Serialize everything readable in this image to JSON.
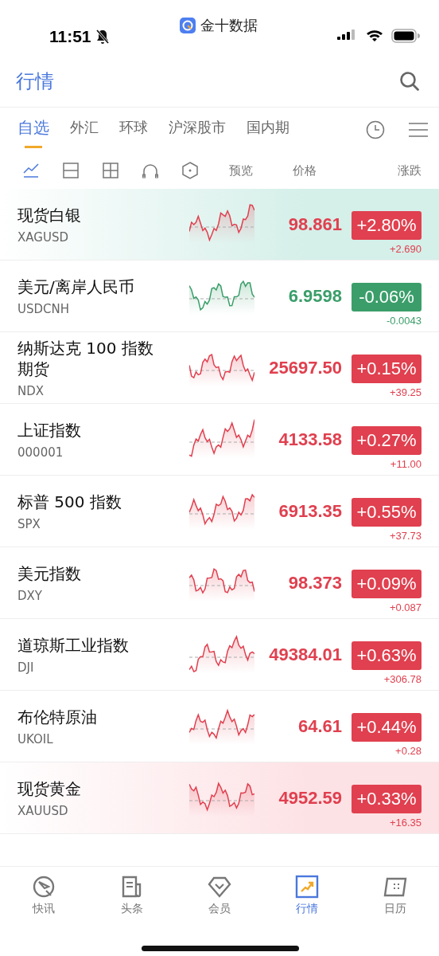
{
  "status_bar": {
    "time": "11:51",
    "back_app": "金十数据"
  },
  "header": {
    "title": "行情"
  },
  "tabs": [
    {
      "label": "自选",
      "selected": true
    },
    {
      "label": "外汇",
      "selected": false
    },
    {
      "label": "环球",
      "selected": false
    },
    {
      "label": "沪深股市",
      "selected": false
    },
    {
      "label": "国内期",
      "selected": false
    }
  ],
  "view_modes": [
    {
      "kind": "line",
      "selected": true
    },
    {
      "kind": "rows",
      "selected": false
    },
    {
      "kind": "grid",
      "selected": false
    },
    {
      "kind": "arch",
      "selected": false
    },
    {
      "kind": "hex",
      "selected": false
    }
  ],
  "columns": [
    "预览",
    "价格",
    "涨跌"
  ],
  "rows": [
    {
      "name": "现货白银",
      "code": "XAGUSD",
      "price": "98.861",
      "percent": "+2.80%",
      "change": "+2.690",
      "rising": true,
      "color": "#d5efe9"
    },
    {
      "name": "美元/离岸人民币",
      "code": "USDCNH",
      "price": "6.9598",
      "percent": "-0.06%",
      "change": "-0.0043",
      "rising": false
    },
    {
      "name": "纳斯达克 100 指数期货",
      "code": "NDX",
      "price": "25697.50",
      "percent": "+0.15%",
      "change": "+39.25",
      "rising": true
    },
    {
      "name": "上证指数",
      "code": "000001",
      "price": "4133.58",
      "percent": "+0.27%",
      "change": "+11.00",
      "rising": true
    },
    {
      "name": "标普 500 指数",
      "code": "SPX",
      "price": "6913.35",
      "percent": "+0.55%",
      "change": "+37.73",
      "rising": true
    },
    {
      "name": "美元指数",
      "code": "DXY",
      "price": "98.373",
      "percent": "+0.09%",
      "change": "+0.087",
      "rising": true
    },
    {
      "name": "道琼斯工业指数",
      "code": "DJI",
      "price": "49384.01",
      "percent": "+0.63%",
      "change": "+306.78",
      "rising": true
    },
    {
      "name": "布伦特原油",
      "code": "UKOIL",
      "price": "64.61",
      "percent": "+0.44%",
      "change": "+0.28",
      "rising": true
    },
    {
      "name": "现货黄金",
      "code": "XAUUSD",
      "price": "4952.59",
      "percent": "+0.33%",
      "change": "+16.35",
      "rising": true,
      "color": "#fde2e5"
    }
  ],
  "nav": [
    {
      "label": "快讯",
      "selected": false
    },
    {
      "label": "头条",
      "selected": false
    },
    {
      "label": "会员",
      "selected": false
    },
    {
      "label": "行情",
      "selected": true
    },
    {
      "label": "日历",
      "selected": false
    }
  ]
}
